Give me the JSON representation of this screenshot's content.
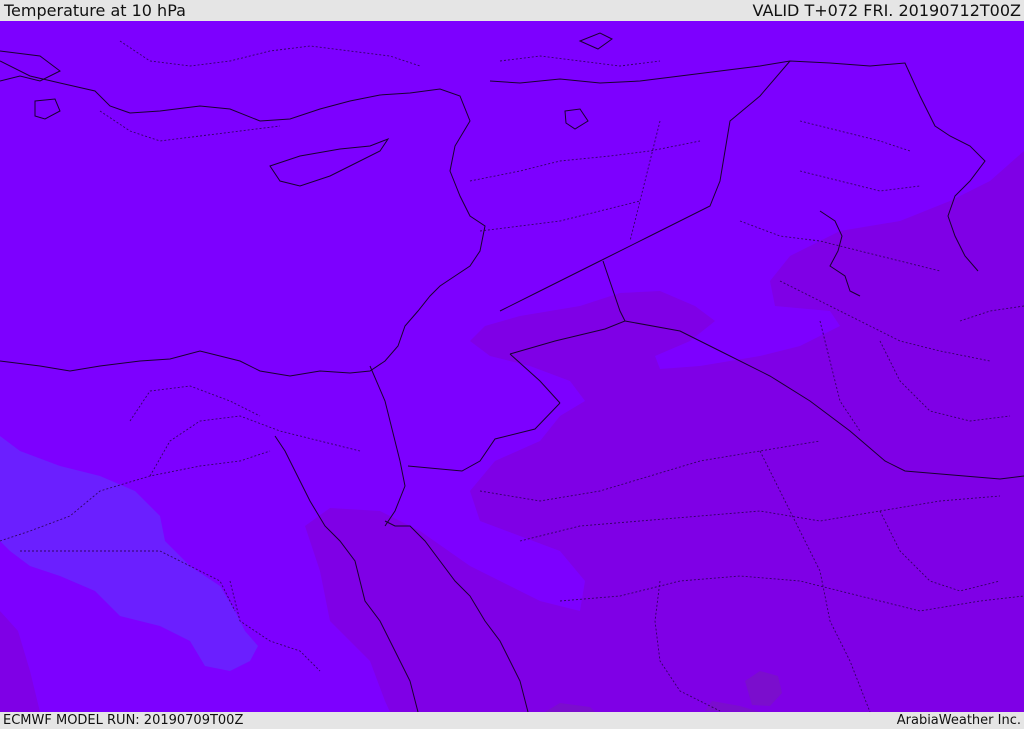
{
  "header": {
    "title": "Temperature at 10 hPa",
    "valid": "VALID T+072 FRI. 20190712T00Z"
  },
  "footer": {
    "model_run": "ECMWF MODEL RUN: 20190709T00Z",
    "credit": "ArabiaWeather Inc."
  },
  "map": {
    "variable": "temperature",
    "level": "10 hPa",
    "colors": {
      "base": "#7d00ff",
      "warmer_band": "#7f00e6",
      "warmest_patch": "#7a10c8",
      "cooler_band": "#6b1fff",
      "coast_border": "#1a0030"
    }
  }
}
